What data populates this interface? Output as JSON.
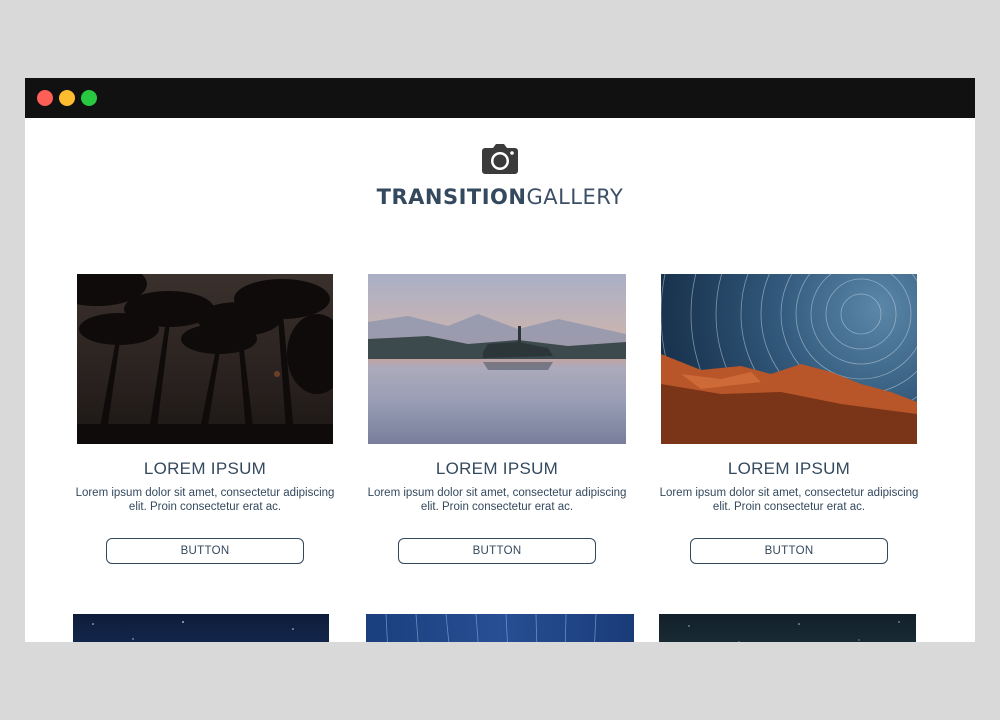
{
  "window": {
    "controls": [
      "close",
      "minimize",
      "maximize"
    ],
    "colors": {
      "close": "#fe5f57",
      "minimize": "#febc2e",
      "maximize": "#28c840"
    }
  },
  "header": {
    "icon": "camera-icon",
    "brand_bold": "TRANSITION",
    "brand_light": "GALLERY"
  },
  "cards": [
    {
      "image": "palm-trees-night",
      "title": "LOREM IPSUM",
      "description": "Lorem ipsum dolor sit amet, consectetur adipiscing elit. Proin consectetur erat ac.",
      "button": "BUTTON"
    },
    {
      "image": "lake-church-sunrise",
      "title": "LOREM IPSUM",
      "description": "Lorem ipsum dolor sit amet, consectetur adipiscing elit. Proin consectetur erat ac.",
      "button": "BUTTON"
    },
    {
      "image": "star-trails-desert",
      "title": "LOREM IPSUM",
      "description": "Lorem ipsum dolor sit amet, consectetur adipiscing elit. Proin consectetur erat ac.",
      "button": "BUTTON"
    }
  ],
  "second_row_images": [
    "starry-sky",
    "star-trails-blue",
    "night-sky-dark"
  ],
  "theme": {
    "text": "#34495e",
    "titlebar": "#111111",
    "page_bg": "#d9d9d9"
  }
}
